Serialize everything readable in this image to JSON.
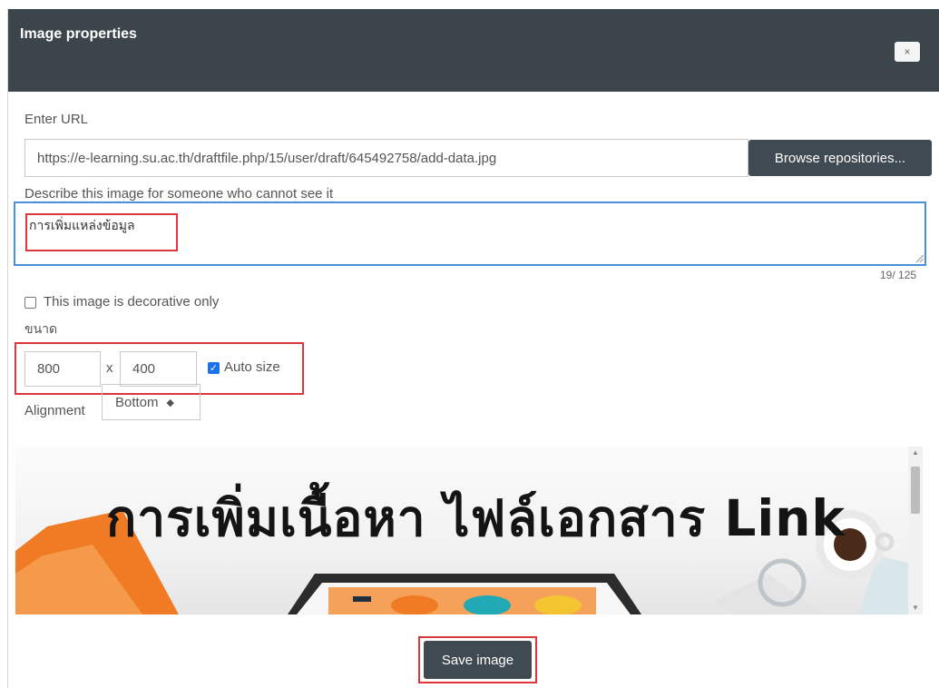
{
  "dialog": {
    "title": "Image properties",
    "close_label": "×"
  },
  "url_section": {
    "label": "Enter URL",
    "value": "https://e-learning.su.ac.th/draftfile.php/15/user/draft/645492758/add-data.jpg",
    "browse_label": "Browse repositories..."
  },
  "alt_section": {
    "label": "Describe this image for someone who cannot see it",
    "value": "การเพิ่มแหล่งข้อมูล",
    "counter": "19/ 125"
  },
  "decorative": {
    "label": "This image is decorative only",
    "checked": false
  },
  "size": {
    "label": "ขนาด",
    "width": "800",
    "separator": "x",
    "height": "400",
    "auto_label": "Auto size",
    "auto_checked": true
  },
  "alignment": {
    "label": "Alignment",
    "selected": "Bottom",
    "caret": "◆"
  },
  "preview": {
    "banner_text": "การเพิ่มเนื้อหา ไฟล์เอกสาร Link"
  },
  "save_label": "Save image",
  "colors": {
    "header": "#3c454c",
    "button": "#3f4a52",
    "highlight_red": "#e0353b",
    "focus_blue": "#4a90d9"
  }
}
